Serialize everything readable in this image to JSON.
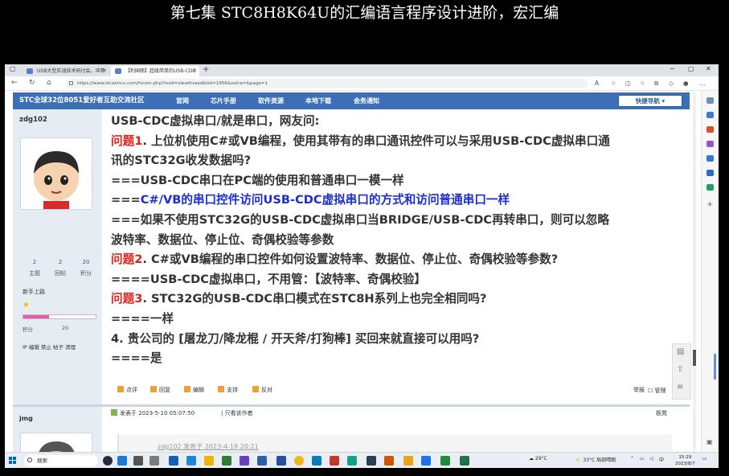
{
  "video_title": "第七集 STC8H8K64U的汇编语言程序设计进阶，宏汇编",
  "browser": {
    "tabs": [
      {
        "label": "USB大型实战技术研讨会。冲哥",
        "active": false
      },
      {
        "label": "【利国丽】超级简单的USB-CDC",
        "active": true
      }
    ],
    "url": "https://www.stcaimcu.com/forum.php?mod=viewthread&tid=1856&extra=&page=1"
  },
  "site": {
    "title": "STC全球32位8051爱好者互助交流社区",
    "nav": [
      "官网",
      "芯片手册",
      "软件资源",
      "本地下载",
      "会务通知"
    ],
    "quicknav": "快捷导航"
  },
  "user": {
    "name": "zdg102",
    "stats": [
      {
        "value": "2",
        "label": "主题"
      },
      {
        "value": "2",
        "label": "回帖"
      },
      {
        "value": "20",
        "label": "积分"
      }
    ],
    "rank": "新手上路",
    "credit_label": "积分",
    "credit_value": "20",
    "credit_fill": 0.35,
    "links": "IP 编辑 禁止 帖子 清理"
  },
  "post": {
    "lines": [
      [
        {
          "text": "USB-CDC虚拟串口/就是串口，网友问:",
          "style": "normal"
        }
      ],
      [
        {
          "text": "问题1",
          "style": "q"
        },
        {
          "text": ". 上位机使用C#或VB编程，使用其带有的串口通讯控件可以与采用USB-CDC虚拟串口通",
          "style": "normal"
        }
      ],
      [
        {
          "text": "讯的STC32G收发数据吗?",
          "style": "normal"
        }
      ],
      [
        {
          "text": "===USB-CDC串口在PC端的使用和普通串口一模一样",
          "style": "normal"
        }
      ],
      [
        {
          "text": "===",
          "style": "normal"
        },
        {
          "text": "C#/VB的串口控件访问USB-CDC虚拟串口的方式和访问普通串口一样",
          "style": "blue"
        }
      ],
      [
        {
          "text": "===如果不使用STC32G的USB-CDC虚拟串口当BRIDGE/USB-CDC再转串口，则可以忽略",
          "style": "normal"
        }
      ],
      [
        {
          "text": "波特率、数据位、停止位、奇偶校验等参数",
          "style": "normal"
        }
      ],
      [
        {
          "text": "问题2",
          "style": "q"
        },
        {
          "text": ". C#或VB编程的串口控件如何设置波特率、数据位、停止位、奇偶校验等参数?",
          "style": "normal"
        }
      ],
      [
        {
          "text": "====USB-CDC虚拟串口，不用管：【波特率、奇偶校验】",
          "style": "normal"
        }
      ],
      [
        {
          "text": "问题3",
          "style": "q"
        },
        {
          "text": ". STC32G的USB-CDC串口模式在STC8H系列上也完全相同吗?",
          "style": "normal"
        }
      ],
      [
        {
          "text": "====一样",
          "style": "normal"
        }
      ],
      [
        {
          "text": "4. 贵公司的 [屠龙刀/降龙棍 / 开天斧/打狗棒] 买回来就直接可以用吗?",
          "style": "normal"
        }
      ],
      [
        {
          "text": "====是",
          "style": "normal"
        }
      ]
    ],
    "actions": [
      "点评",
      "回复",
      "编辑",
      "支持",
      "反对"
    ],
    "report": "举报",
    "mgmt": "管理"
  },
  "reply": {
    "username": "jmg",
    "posted": "发表于 2023-5-10 05:07:50",
    "author_only": "只看该作者",
    "floor": "板凳",
    "quote": "zdg102 发表于 2023-4-18 20:21"
  },
  "taskbar": {
    "search": "搜索",
    "weather_temp": "29°C",
    "weather_text": "33°C 局部晴朗",
    "ime": "中",
    "time": "15:29",
    "date": "2023/8/7"
  }
}
